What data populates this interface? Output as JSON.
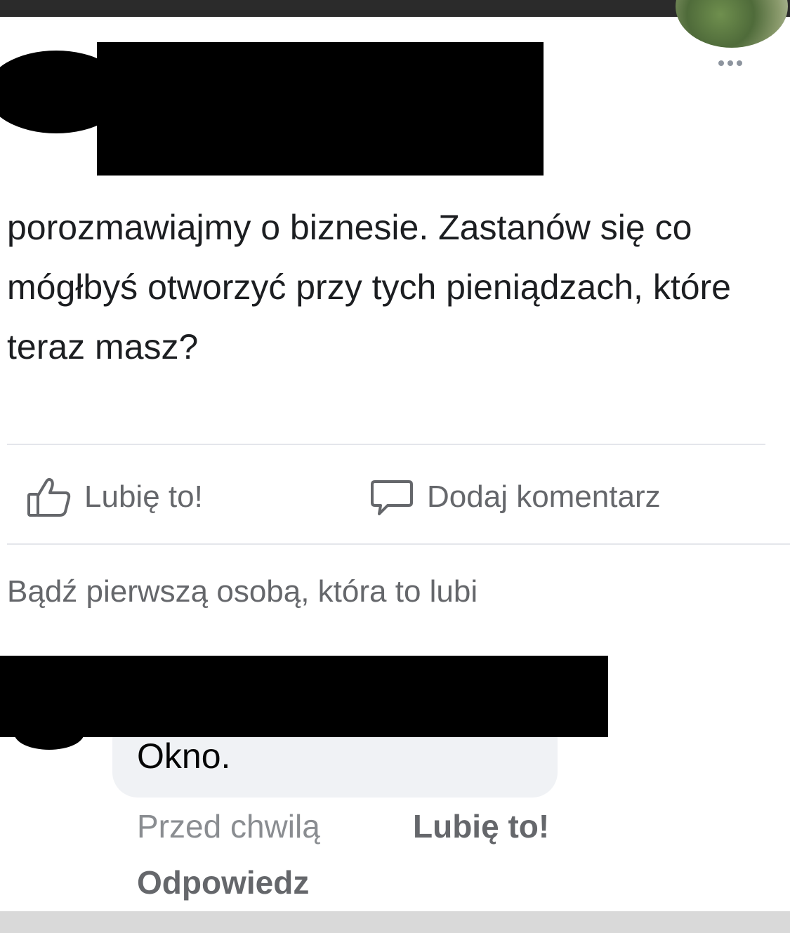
{
  "post": {
    "text": "porozmawiajmy o biznesie. Zastanów się co mógłbyś otworzyć przy tych pieniądzach, które teraz masz?",
    "more_icon": "more-horizontal-icon"
  },
  "actions": {
    "like_label": "Lubię to!",
    "like_icon": "thumbs-up-icon",
    "comment_label": "Dodaj komentarz",
    "comment_icon": "speech-bubble-icon"
  },
  "likes_summary": "Bądź pierwszą osobą, która to lubi",
  "comment": {
    "text": "Okno.",
    "timestamp": "Przed chwilą",
    "like_label": "Lubię to!",
    "reply_label": "Odpowiedz"
  },
  "colors": {
    "text_primary": "#1c1e21",
    "text_secondary": "#65676b",
    "bubble_bg": "#f0f2f5",
    "redaction": "#000000"
  }
}
